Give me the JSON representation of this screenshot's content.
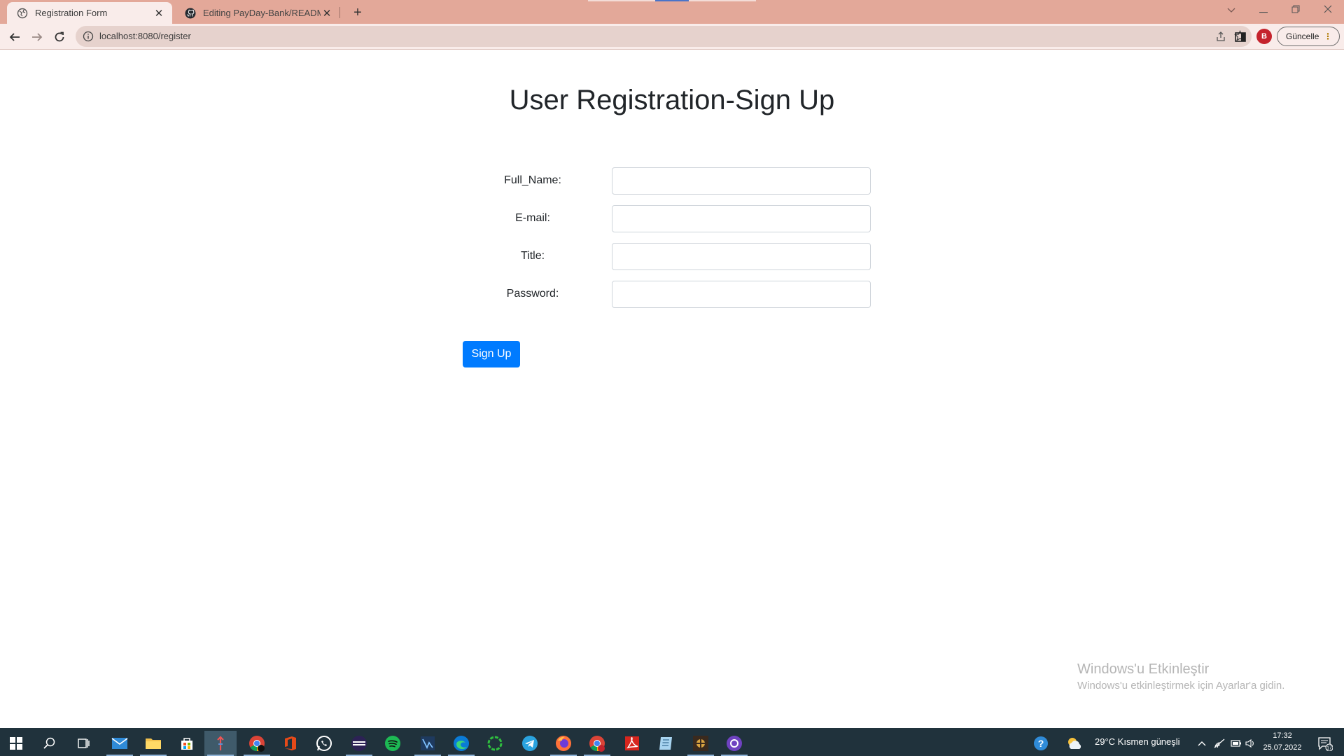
{
  "browser": {
    "tabs": [
      {
        "title": "Registration Form",
        "active": true
      },
      {
        "title": "Editing PayDay-Bank/README.m",
        "active": false
      }
    ],
    "url": "localhost:8080/register",
    "profile_initial": "B",
    "update_label": "Güncelle"
  },
  "page": {
    "title": "User Registration-Sign Up",
    "fields": [
      {
        "label": "Full_Name:",
        "value": ""
      },
      {
        "label": "E-mail:",
        "value": ""
      },
      {
        "label": "Title:",
        "value": ""
      },
      {
        "label": "Password:",
        "value": ""
      }
    ],
    "submit_label": "Sign Up"
  },
  "watermark": {
    "title": "Windows'u Etkinleştir",
    "subtitle": "Windows'u etkinleştirmek için Ayarlar'a gidin."
  },
  "taskbar": {
    "apps": [
      "mail-icon",
      "file-explorer-icon",
      "store-icon",
      "app-icon",
      "chrome-icon",
      "office-icon",
      "whatsapp-icon",
      "eclipse-icon",
      "spotify-icon",
      "vscode-icon",
      "edge-icon",
      "process-icon",
      "telegram-icon",
      "firefox-icon",
      "chrome-profile-icon",
      "acrobat-icon",
      "notepad-icon",
      "game-icon",
      "github-desktop-icon"
    ],
    "weather": "29°C  Kısmen güneşli",
    "time": "17:32",
    "date": "25.07.2022",
    "notification_count": "17"
  },
  "colors": {
    "titlebar": "#e3a899",
    "toolbar": "#f9ecea",
    "primary_button": "#007bff",
    "taskbar": "#20323c"
  }
}
